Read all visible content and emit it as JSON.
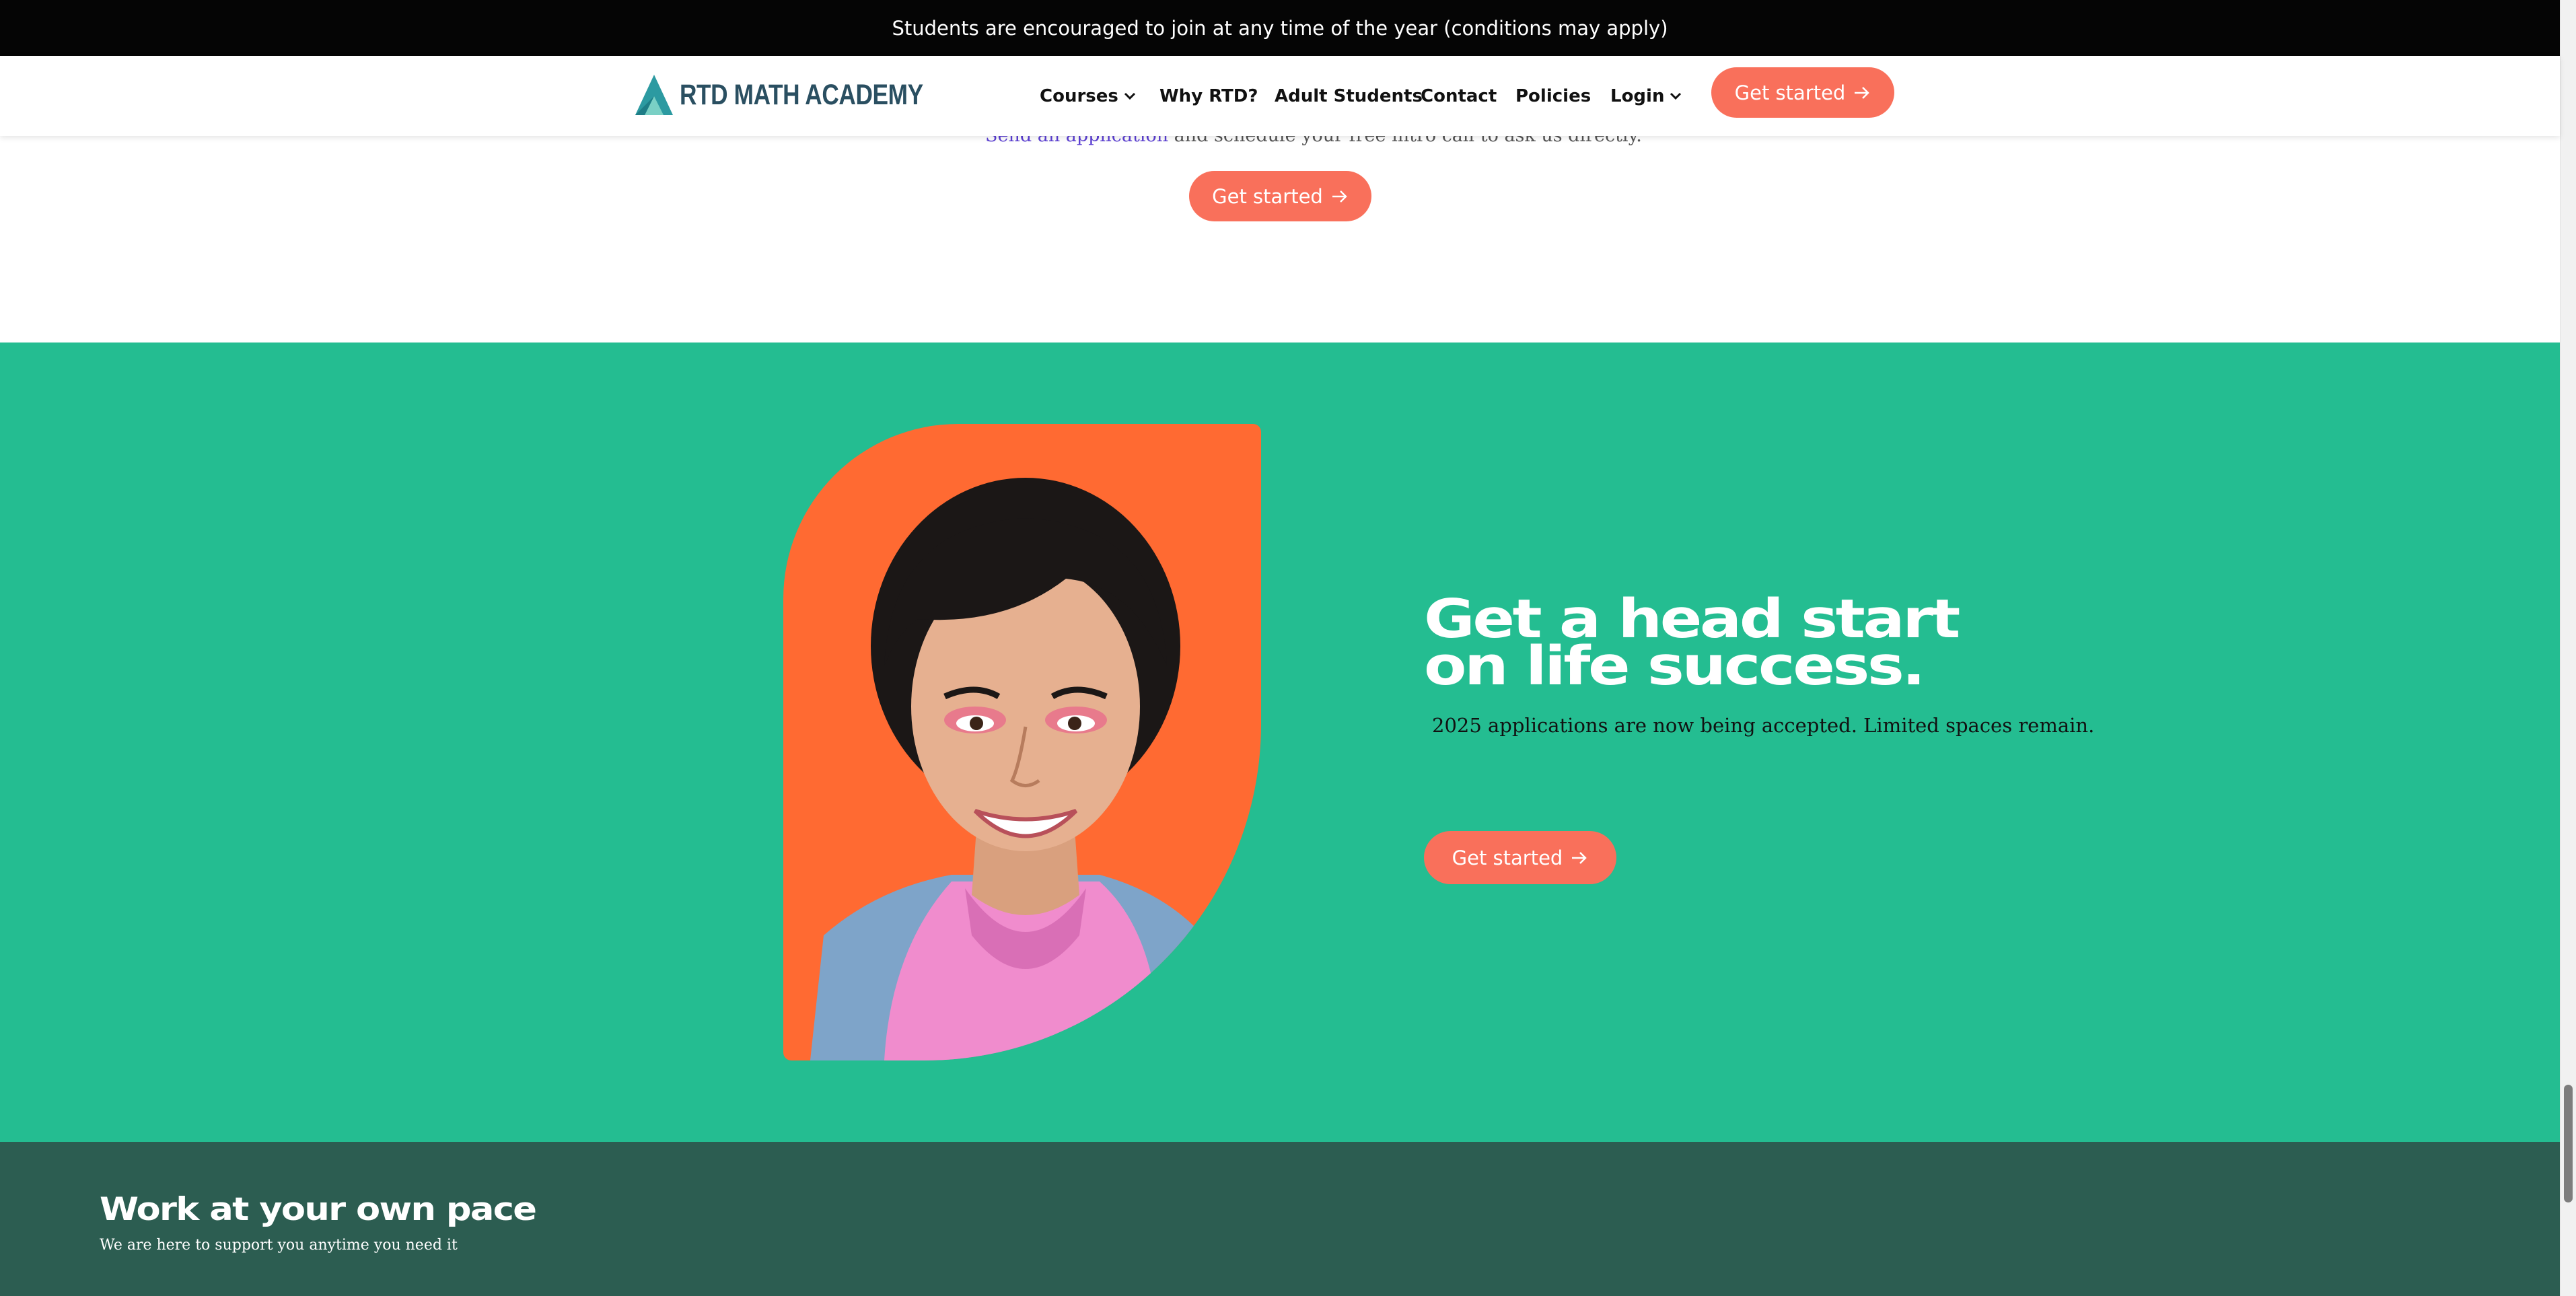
{
  "announcement": {
    "text": "Students are encouraged to join at any time of the year (conditions may apply)"
  },
  "header": {
    "logo_text": "RTD MATH ACADEMY",
    "nav": {
      "courses": "Courses",
      "why": "Why RTD?",
      "adult": "Adult Students",
      "contact": "Contact",
      "policies": "Policies",
      "login": "Login"
    },
    "cta_label": "Get started"
  },
  "intro": {
    "link_text": "Send an application",
    "rest_text": " and schedule your free intro call to ask us directly.",
    "cta_label": "Get started"
  },
  "promo": {
    "headline_line1": "Get a head start",
    "headline_line2": "on life success.",
    "subtext": "2025  applications are now being accepted. Limited spaces remain.",
    "cta_label": "Get started"
  },
  "pace": {
    "title": "Work at your own pace",
    "subtitle": "We are here to support you anytime you need it"
  },
  "colors": {
    "accent": "#f9705b",
    "green": "#24bd91",
    "dark_green": "#2c5d51",
    "photo_bg": "#ff6a32",
    "logo": "#2a4f61"
  }
}
